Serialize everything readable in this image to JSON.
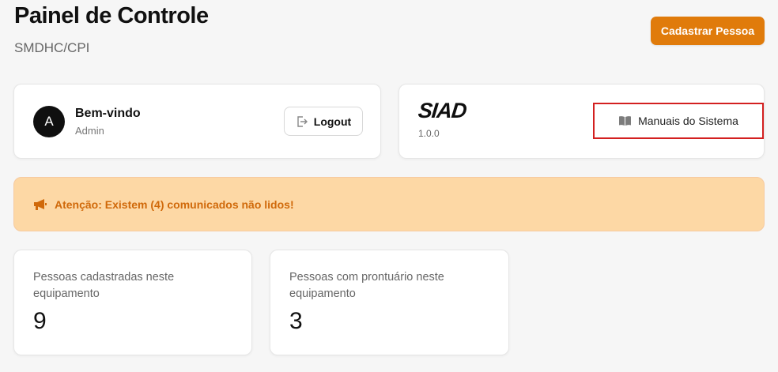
{
  "header": {
    "title": "Painel de Controle",
    "subtitle": "SMDHC/CPI",
    "primary_button": "Cadastrar Pessoa"
  },
  "user_card": {
    "avatar_initial": "A",
    "welcome": "Bem-vindo",
    "role": "Admin",
    "logout_label": "Logout",
    "logout_icon": "logout-icon"
  },
  "system_card": {
    "logo_text": "SIAD",
    "version": "1.0.0",
    "manuals_label": "Manuais do Sistema",
    "manuals_icon": "book-icon"
  },
  "alert": {
    "text": "Atenção: Existem (4) comunicados não lidos!",
    "icon": "megaphone-icon"
  },
  "stats": [
    {
      "label": "Pessoas cadastradas neste equipamento",
      "value": "9"
    },
    {
      "label": "Pessoas com prontuário neste equipamento",
      "value": "3"
    }
  ],
  "colors": {
    "accent": "#e07b0b",
    "alert_bg": "#fdd8a5",
    "alert_text": "#d0690a",
    "highlight_border": "#d32020"
  }
}
